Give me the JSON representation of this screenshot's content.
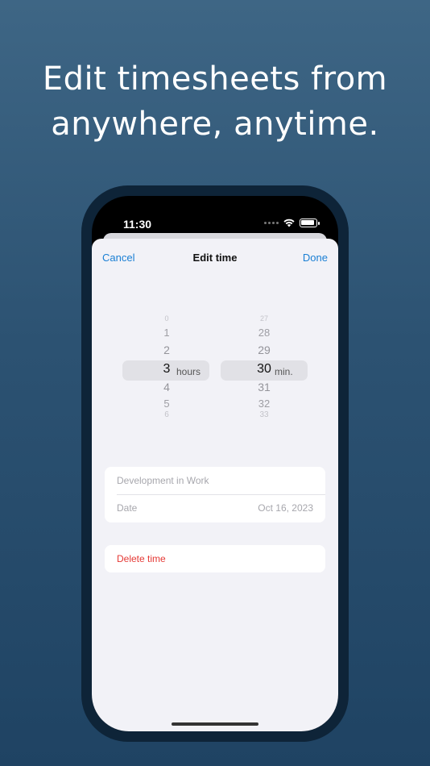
{
  "headline": {
    "line1": "Edit timesheets from",
    "line2": "anywhere, anytime."
  },
  "status_bar": {
    "time": "11:30"
  },
  "nav": {
    "cancel": "Cancel",
    "title": "Edit time",
    "done": "Done"
  },
  "picker": {
    "hours": {
      "values": [
        "0",
        "1",
        "2",
        "3",
        "4",
        "5",
        "6"
      ],
      "selected": "3",
      "unit": "hours"
    },
    "minutes": {
      "values": [
        "27",
        "28",
        "29",
        "30",
        "31",
        "32",
        "33"
      ],
      "selected": "30",
      "unit": "min."
    }
  },
  "details": {
    "project": "Development in Work",
    "date_label": "Date",
    "date_value": "Oct 16, 2023"
  },
  "actions": {
    "delete": "Delete time"
  },
  "colors": {
    "accent": "#1a7fd4",
    "destructive": "#e53935",
    "background": "#2c5272"
  }
}
